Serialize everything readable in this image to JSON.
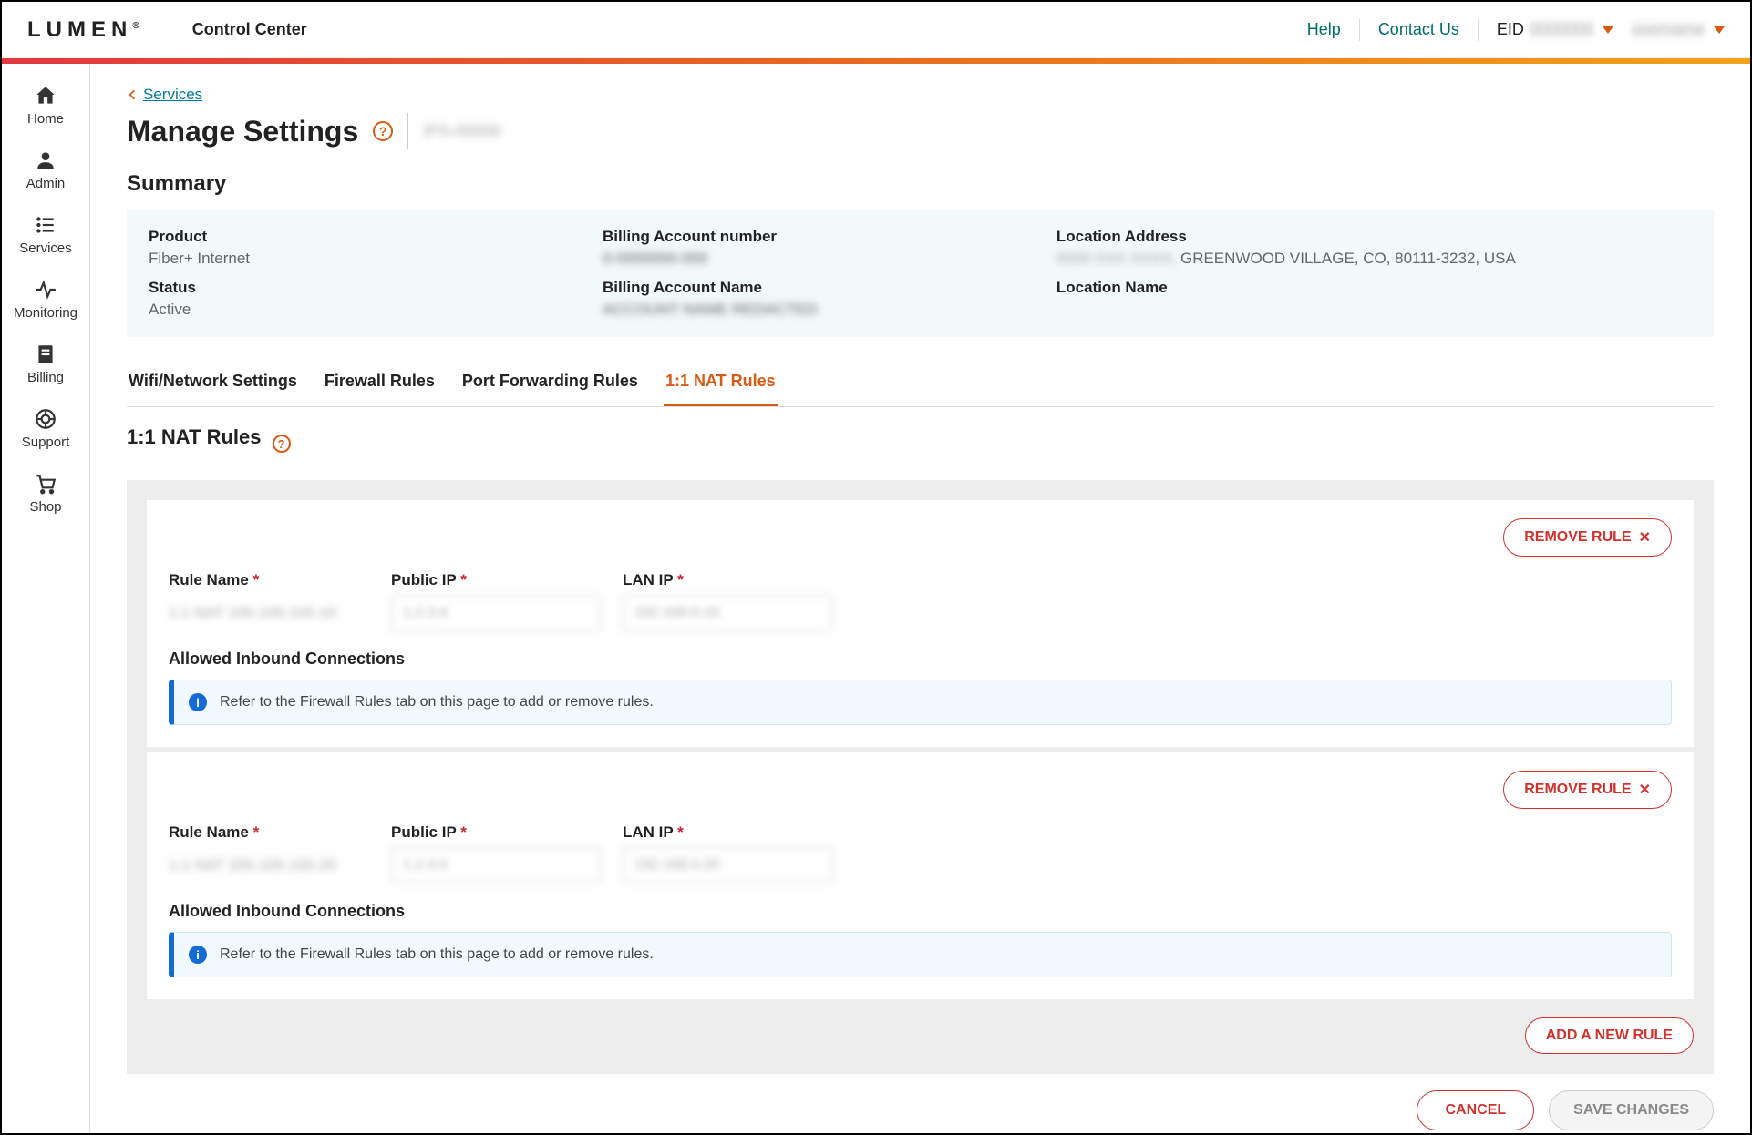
{
  "topbar": {
    "logo": "LUMEN",
    "app_name": "Control Center",
    "help": "Help",
    "contact": "Contact Us",
    "eid_label": "EID",
    "eid_value": "0000000",
    "user_value": "username"
  },
  "sidebar": {
    "items": [
      {
        "label": "Home"
      },
      {
        "label": "Admin"
      },
      {
        "label": "Services"
      },
      {
        "label": "Monitoring"
      },
      {
        "label": "Billing"
      },
      {
        "label": "Support"
      },
      {
        "label": "Shop"
      }
    ]
  },
  "breadcrumb": {
    "services": "Services"
  },
  "page": {
    "title": "Manage Settings",
    "subtitle_id": "IPS-00000"
  },
  "summary": {
    "heading": "Summary",
    "product_label": "Product",
    "product_value": "Fiber+ Internet",
    "status_label": "Status",
    "status_value": "Active",
    "ban_label": "Billing Account number",
    "ban_value": "0-0000000-000",
    "baname_label": "Billing Account Name",
    "baname_value": "ACCOUNT NAME REDACTED",
    "loc_addr_label": "Location Address",
    "loc_addr_value": " GREENWOOD VILLAGE, CO, 80111-3232, USA",
    "loc_addr_prefix": "0000 XXX XXXX,",
    "loc_name_label": "Location Name"
  },
  "tabs": {
    "wifi": "Wifi/Network Settings",
    "firewall": "Firewall Rules",
    "portfwd": "Port Forwarding Rules",
    "nat": "1:1 NAT Rules"
  },
  "nat": {
    "heading": "1:1 NAT Rules",
    "remove_label": "REMOVE RULE",
    "rule_name_label": "Rule Name",
    "public_ip_label": "Public IP",
    "lan_ip_label": "LAN IP",
    "allowed_in_label": "Allowed Inbound Connections",
    "info_msg": "Refer to the Firewall Rules tab on this page to add or remove rules.",
    "add_rule": "ADD A NEW RULE",
    "rules": [
      {
        "name_value": "1:1 NAT 100.100.100.10",
        "public_ip_value": "1.2.3.4",
        "lan_ip_value": "192.168.0.10"
      },
      {
        "name_value": "1:1 NAT 200.100.100.20",
        "public_ip_value": "1.2.3.5",
        "lan_ip_value": "192.168.0.20"
      }
    ]
  },
  "actions": {
    "cancel": "CANCEL",
    "save": "SAVE CHANGES"
  }
}
